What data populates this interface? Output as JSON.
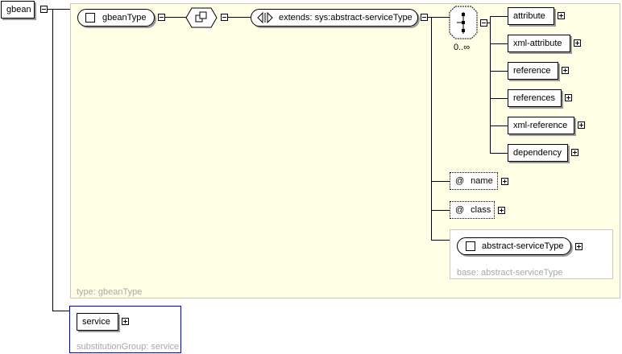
{
  "root": {
    "label": "gbean"
  },
  "type_panel": {
    "caption": "type: gbeanType"
  },
  "gbean_type": {
    "label": "gbeanType"
  },
  "extends_node": {
    "label": "extends: sys:abstract-serviceType"
  },
  "sequence": {
    "cardinality": "0..∞"
  },
  "choice_items": [
    {
      "label": "attribute"
    },
    {
      "label": "xml-attribute"
    },
    {
      "label": "reference"
    },
    {
      "label": "references"
    },
    {
      "label": "xml-reference"
    },
    {
      "label": "dependency"
    }
  ],
  "attributes": [
    {
      "symbol": "@",
      "label": "name"
    },
    {
      "symbol": "@",
      "label": "class"
    }
  ],
  "base_panel": {
    "type_label": "abstract-serviceType",
    "caption": "base: abstract-serviceType"
  },
  "substitution": {
    "label": "service",
    "caption": "substitutionGroup: service"
  }
}
